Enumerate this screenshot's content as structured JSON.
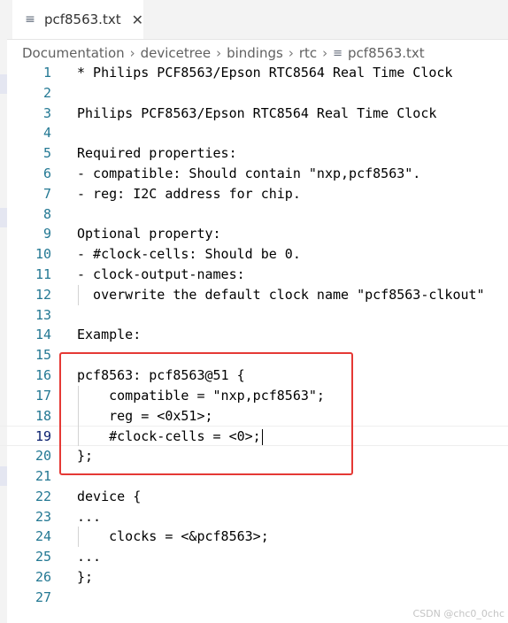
{
  "tab": {
    "filename": "pcf8563.txt",
    "icon": "file-lines-icon"
  },
  "breadcrumb": [
    "Documentation",
    "devicetree",
    "bindings",
    "rtc",
    "pcf8563.txt"
  ],
  "editor": {
    "lines": [
      {
        "n": "1",
        "text": "* Philips PCF8563/Epson RTC8564 Real Time Clock"
      },
      {
        "n": "2",
        "text": ""
      },
      {
        "n": "3",
        "text": "Philips PCF8563/Epson RTC8564 Real Time Clock"
      },
      {
        "n": "4",
        "text": ""
      },
      {
        "n": "5",
        "text": "Required properties:"
      },
      {
        "n": "6",
        "text": "- compatible: Should contain \"nxp,pcf8563\"."
      },
      {
        "n": "7",
        "text": "- reg: I2C address for chip."
      },
      {
        "n": "8",
        "text": ""
      },
      {
        "n": "9",
        "text": "Optional property:"
      },
      {
        "n": "10",
        "text": "- #clock-cells: Should be 0."
      },
      {
        "n": "11",
        "text": "- clock-output-names:"
      },
      {
        "n": "12",
        "text": "  overwrite the default clock name \"pcf8563-clkout\""
      },
      {
        "n": "13",
        "text": ""
      },
      {
        "n": "14",
        "text": "Example:"
      },
      {
        "n": "15",
        "text": ""
      },
      {
        "n": "16",
        "text": "pcf8563: pcf8563@51 {"
      },
      {
        "n": "17",
        "text": "    compatible = \"nxp,pcf8563\";"
      },
      {
        "n": "18",
        "text": "    reg = <0x51>;"
      },
      {
        "n": "19",
        "text": "    #clock-cells = <0>;"
      },
      {
        "n": "20",
        "text": "};"
      },
      {
        "n": "21",
        "text": ""
      },
      {
        "n": "22",
        "text": "device {"
      },
      {
        "n": "23",
        "text": "..."
      },
      {
        "n": "24",
        "text": "    clocks = <&pcf8563>;"
      },
      {
        "n": "25",
        "text": "..."
      },
      {
        "n": "26",
        "text": "};"
      },
      {
        "n": "27",
        "text": ""
      }
    ],
    "active_line": 19
  },
  "watermark": "CSDN @chc0_0chc",
  "colors": {
    "highlight_box": "#e53935",
    "line_number": "#237893"
  }
}
